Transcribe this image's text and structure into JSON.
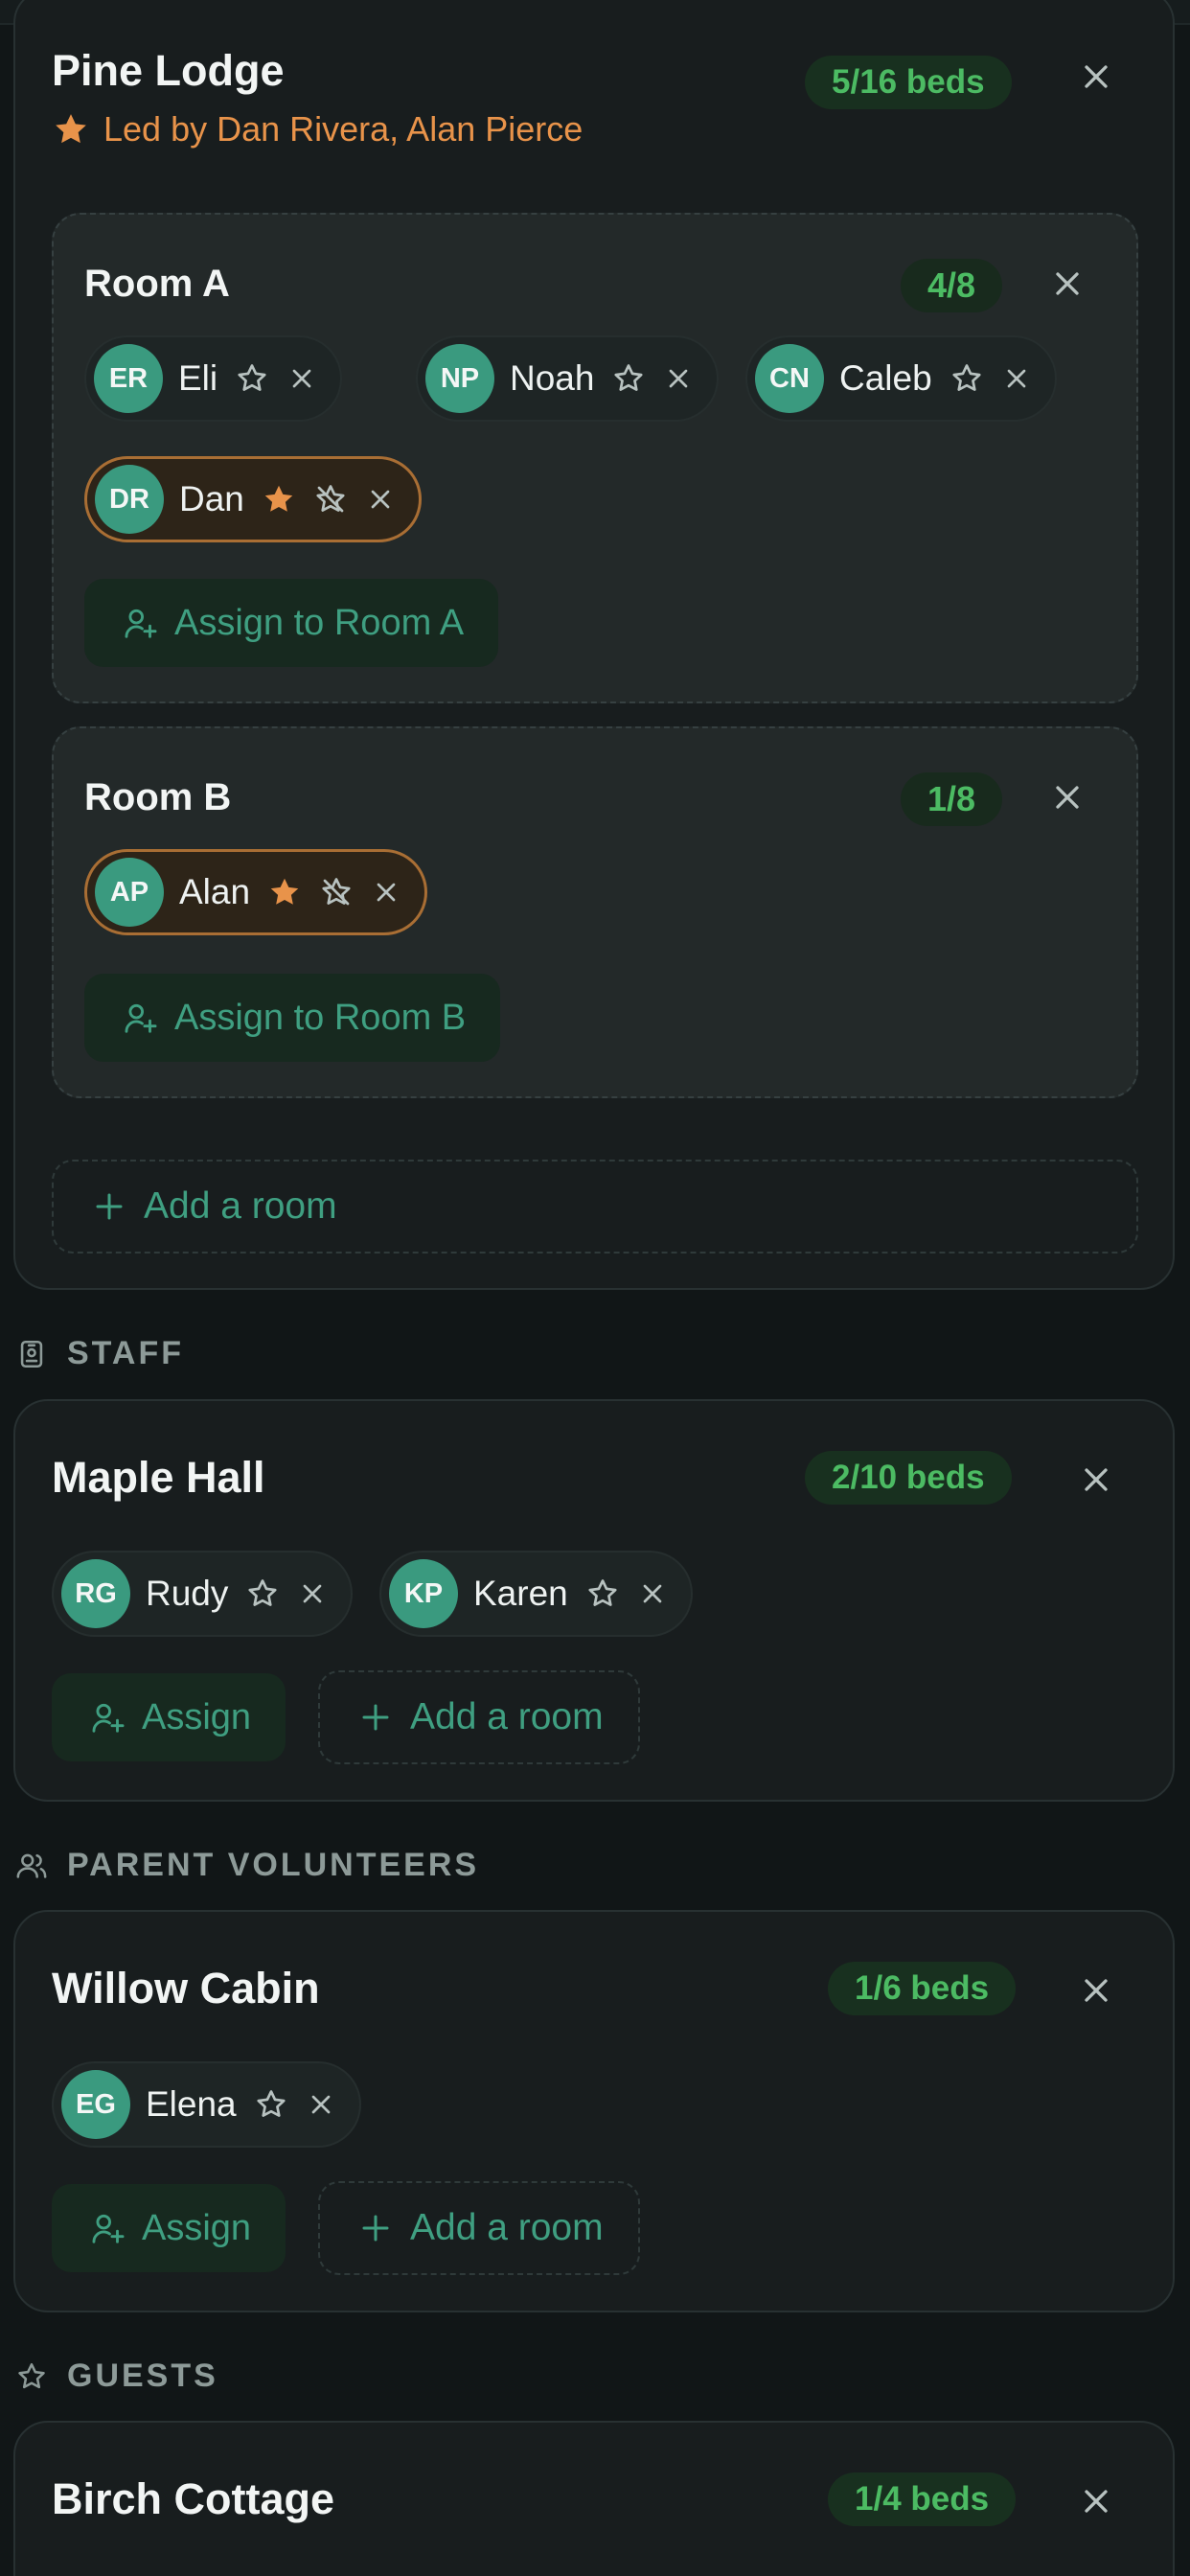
{
  "colors": {
    "background": "#111617",
    "card": "#181d1e",
    "accent": "#3a9a7f",
    "beds_text": "#4cbb63",
    "leader": "#e8934a"
  },
  "pine": {
    "title": "Pine Lodge",
    "beds": "5/16 beds",
    "leaders": "Led by Dan Rivera, Alan Pierce",
    "rooms": [
      {
        "title": "Room A",
        "count": "4/8",
        "members": [
          {
            "initials": "ER",
            "name": "Eli",
            "leader": false
          },
          {
            "initials": "NP",
            "name": "Noah",
            "leader": false
          },
          {
            "initials": "CN",
            "name": "Caleb",
            "leader": false
          },
          {
            "initials": "DR",
            "name": "Dan",
            "leader": true
          }
        ],
        "assign_label": "Assign to Room A"
      },
      {
        "title": "Room B",
        "count": "1/8",
        "members": [
          {
            "initials": "AP",
            "name": "Alan",
            "leader": true
          }
        ],
        "assign_label": "Assign to Room B"
      }
    ],
    "add_room_label": "Add a room"
  },
  "sections": [
    {
      "label": "STAFF",
      "icon": "badge-icon",
      "cabin": {
        "title": "Maple Hall",
        "beds": "2/10 beds",
        "members": [
          {
            "initials": "RG",
            "name": "Rudy"
          },
          {
            "initials": "KP",
            "name": "Karen"
          }
        ],
        "assign_label": "Assign",
        "add_room_label": "Add a room"
      }
    },
    {
      "label": "PARENT VOLUNTEERS",
      "icon": "users-icon",
      "cabin": {
        "title": "Willow Cabin",
        "beds": "1/6 beds",
        "members": [
          {
            "initials": "EG",
            "name": "Elena"
          }
        ],
        "assign_label": "Assign",
        "add_room_label": "Add a room"
      }
    },
    {
      "label": "GUESTS",
      "icon": "star-outline-icon",
      "cabin": {
        "title": "Birch Cottage",
        "beds": "1/4 beds"
      }
    }
  ]
}
